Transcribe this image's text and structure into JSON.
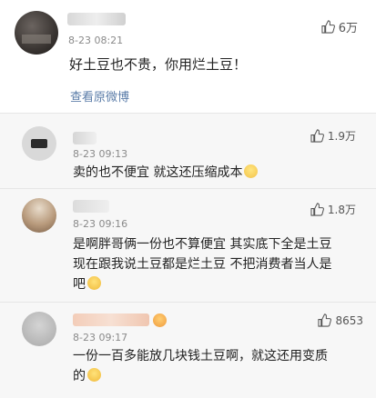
{
  "post": {
    "time": "8-23 08:21",
    "likes": "6万",
    "text": "好土豆也不贵，你用烂土豆！",
    "view_original": "查看原微博"
  },
  "replies": [
    {
      "time": "8-23 09:13",
      "likes": "1.9万",
      "text": "卖的也不便宜 就这还压缩成本"
    },
    {
      "time": "8-23 09:16",
      "likes": "1.8万",
      "line1": "是啊胖哥俩一份也不算便宜 其实底下全是土豆",
      "line2": "现在跟我说土豆都是烂土豆 不把消费者当人是",
      "line3": "吧"
    },
    {
      "time": "8-23 09:17",
      "likes": "8653",
      "line1": "一份一百多能放几块钱土豆啊，就这还用变质",
      "line2": "的"
    }
  ],
  "icons": {
    "like": "thumbs-up-icon",
    "emoji_worry": "emoji-worried-face",
    "emoji_cry": "emoji-crying-face",
    "emoji_angry": "emoji-angry-face"
  },
  "colors": {
    "link": "#5a7ca8",
    "background": "#f2f2f2"
  }
}
